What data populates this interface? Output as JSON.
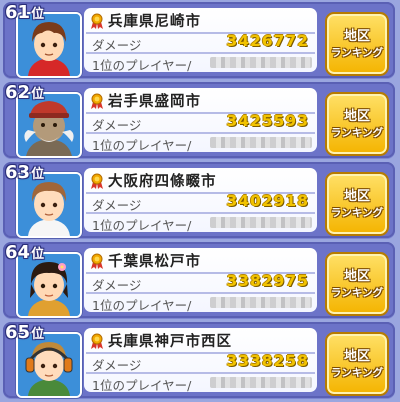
{
  "rows": [
    {
      "rank": "61",
      "rank_suffix": "位",
      "city": "兵庫県尼崎市",
      "damage_label": "ダメージ",
      "score": "3426772",
      "top_player_label": "1位のプレイヤー/",
      "btn_line1": "地区",
      "btn_line2": "ランキング",
      "avatar": "avatar-boy-red-shirt"
    },
    {
      "rank": "62",
      "rank_suffix": "位",
      "city": "岩手県盛岡市",
      "damage_label": "ダメージ",
      "score": "3425593",
      "top_player_label": "1位のプレイヤー/",
      "btn_line1": "地区",
      "btn_line2": "ランキング",
      "avatar": "avatar-old-man-red-cap"
    },
    {
      "rank": "63",
      "rank_suffix": "位",
      "city": "大阪府四條畷市",
      "damage_label": "ダメージ",
      "score": "3402918",
      "top_player_label": "1位のプレイヤー/",
      "btn_line1": "地区",
      "btn_line2": "ランキング",
      "avatar": "avatar-boy-brown-hair"
    },
    {
      "rank": "64",
      "rank_suffix": "位",
      "city": "千葉県松戸市",
      "damage_label": "ダメージ",
      "score": "3382975",
      "top_player_label": "1位のプレイヤー/",
      "btn_line1": "地区",
      "btn_line2": "ランキング",
      "avatar": "avatar-girl-flower"
    },
    {
      "rank": "65",
      "rank_suffix": "位",
      "city": "兵庫県神戸市西区",
      "damage_label": "ダメージ",
      "score": "3338258",
      "top_player_label": "1位のプレイヤー/",
      "btn_line1": "地区",
      "btn_line2": "ランキング",
      "avatar": "avatar-boy-headphones"
    }
  ],
  "colors": {
    "background": "#9aa6df",
    "row_frame": "#6c73c8",
    "score": "#f2c300",
    "button": "#f4b400",
    "avatar_bg": "#3c8fd9"
  }
}
